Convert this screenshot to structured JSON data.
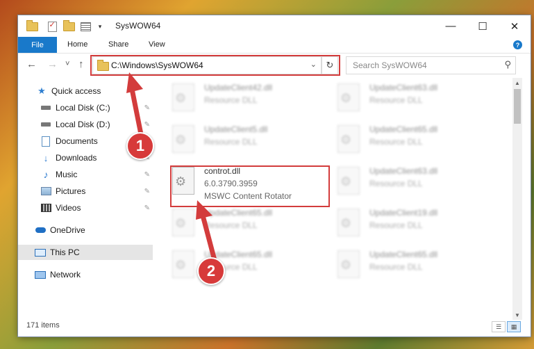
{
  "titlebar": {
    "title": "SysWOW64",
    "minimize": "—",
    "maximize": "☐",
    "close": "✕"
  },
  "ribbon": {
    "file": "File",
    "home": "Home",
    "share": "Share",
    "view": "View",
    "help": "?"
  },
  "address": {
    "path": "C:\\Windows\\SysWOW64",
    "dropdown": "⌄",
    "refresh": "↻"
  },
  "nav": {
    "back": "←",
    "forward": "→",
    "recent": "˅",
    "up": "↑"
  },
  "search": {
    "placeholder": "Search SysWOW64",
    "icon": "⚲"
  },
  "sidebar": {
    "items": [
      {
        "label": "Quick access",
        "icon": "star-icon"
      },
      {
        "label": "Local Disk (C:)",
        "icon": "disk-icon",
        "pinned": true
      },
      {
        "label": "Local Disk (D:)",
        "icon": "disk-icon",
        "pinned": true
      },
      {
        "label": "Documents",
        "icon": "documents-icon",
        "pinned": true
      },
      {
        "label": "Downloads",
        "icon": "downloads-icon",
        "pinned": true
      },
      {
        "label": "Music",
        "icon": "music-icon",
        "pinned": true
      },
      {
        "label": "Pictures",
        "icon": "pictures-icon",
        "pinned": true
      },
      {
        "label": "Videos",
        "icon": "videos-icon",
        "pinned": true
      },
      {
        "label": "OneDrive",
        "icon": "onedrive-icon"
      },
      {
        "label": "This PC",
        "icon": "pc-icon",
        "selected": true
      },
      {
        "label": "Network",
        "icon": "network-icon"
      }
    ],
    "pin_glyph": "📌"
  },
  "files": [
    {
      "name": "UpdateClient42.dll",
      "line2": "Resource DLL",
      "line3": "",
      "blurred": true
    },
    {
      "name": "UpdateClient63.dll",
      "line2": "Resource DLL",
      "line3": "",
      "blurred": true
    },
    {
      "name": "UpdateClient5.dll",
      "line2": "Resource DLL",
      "line3": "",
      "blurred": true
    },
    {
      "name": "UpdateClient65.dll",
      "line2": "Resource DLL",
      "line3": "",
      "blurred": true
    },
    {
      "name": "controt.dll",
      "line2": "6.0.3790.3959",
      "line3": "MSWC Content Rotator",
      "blurred": false
    },
    {
      "name": "UpdateClient63.dll",
      "line2": "Resource DLL",
      "line3": "",
      "blurred": true
    },
    {
      "name": "UpdateClient65.dll",
      "line2": "Resource DLL",
      "line3": "",
      "blurred": true
    },
    {
      "name": "UpdateClient19.dll",
      "line2": "Resource DLL",
      "line3": "",
      "blurred": true
    },
    {
      "name": "UpdateClient65.dll",
      "line2": "Resource DLL",
      "line3": "",
      "blurred": true
    },
    {
      "name": "UpdateClient65.dll",
      "line2": "Resource DLL",
      "line3": "",
      "blurred": true
    }
  ],
  "status": {
    "count": "171 items",
    "details_view": "☰",
    "tiles_view": "▦"
  },
  "annotations": {
    "step1": "1",
    "step2": "2",
    "color": "#d33c3c"
  }
}
